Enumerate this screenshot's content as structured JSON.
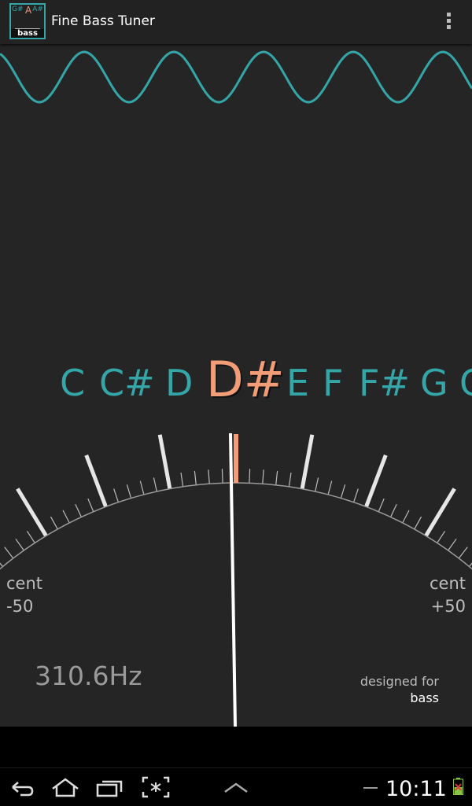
{
  "app": {
    "title": "Fine Bass Tuner",
    "icon": {
      "left_note": "G#",
      "center_note": "A",
      "right_note": "A#",
      "bottom_label": "bass"
    }
  },
  "colors": {
    "accent": "#35a6a8",
    "active_note": "#f39c78",
    "background": "#252525",
    "needle": "#ffffff"
  },
  "tuner": {
    "notes": [
      "C",
      "C#",
      "D",
      "D#",
      "E",
      "F",
      "F#",
      "G",
      "G"
    ],
    "active_note": "D#",
    "active_index": 3,
    "cent_left": {
      "label": "cent",
      "value": "-50"
    },
    "cent_right": {
      "label": "cent",
      "value": "+50"
    },
    "frequency": "310.6Hz",
    "designed_for_label": "designed for",
    "designed_for_value": "bass"
  },
  "status_bar": {
    "time": "10:11"
  },
  "icons": {
    "menu": "overflow-menu-icon",
    "back": "back-icon",
    "home": "home-icon",
    "recents": "recent-apps-icon",
    "screenshot": "screenshot-icon",
    "up": "chevron-up-icon",
    "battery": "battery-charging-icon"
  }
}
